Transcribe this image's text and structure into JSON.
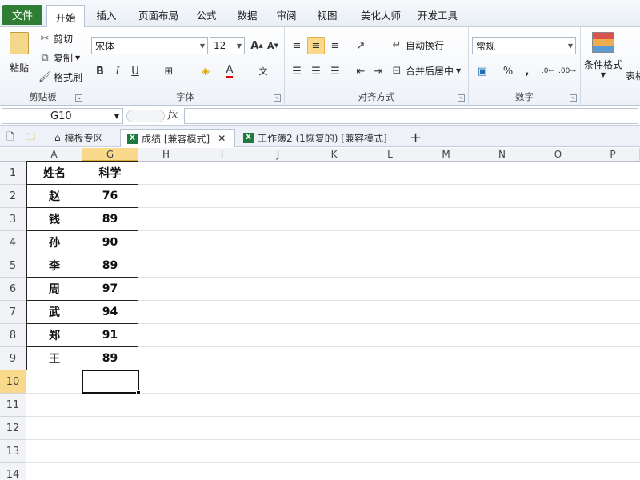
{
  "menu": {
    "file": "文件",
    "tabs": [
      "开始",
      "插入",
      "页面布局",
      "公式",
      "数据",
      "审阅",
      "视图",
      "美化大师",
      "开发工具"
    ]
  },
  "ribbon": {
    "clipboard": {
      "paste": "粘贴",
      "cut": "剪切",
      "copy": "复制",
      "format_painter": "格式刷",
      "label": "剪贴板"
    },
    "font": {
      "name": "宋体",
      "size": "12",
      "bold": "B",
      "italic": "I",
      "underline": "U",
      "label": "字体"
    },
    "alignment": {
      "wrap": "自动换行",
      "merge": "合并后居中",
      "label": "对齐方式"
    },
    "number": {
      "format": "常规",
      "percent": "%",
      "comma": ",",
      "label": "数字"
    },
    "styles": {
      "conditional": "条件格式",
      "table": "表格"
    }
  },
  "formula_bar": {
    "name_box": "G10",
    "fx": "fx",
    "value": ""
  },
  "doc_tabs": [
    {
      "label": "模板专区",
      "icon": "home-icon"
    },
    {
      "label": "成绩 [兼容模式]",
      "icon": "excel-icon",
      "active": true
    },
    {
      "label": "工作簿2 (1恢复的) [兼容模式]",
      "icon": "excel-icon"
    }
  ],
  "columns": [
    "A",
    "G",
    "H",
    "I",
    "J",
    "K",
    "L",
    "M",
    "N",
    "O",
    "P"
  ],
  "rows": [
    "1",
    "2",
    "3",
    "4",
    "5",
    "6",
    "7",
    "8",
    "9",
    "10",
    "11",
    "12",
    "13",
    "14"
  ],
  "table": {
    "headers": [
      "姓名",
      "科学"
    ],
    "rows": [
      [
        "赵",
        "76"
      ],
      [
        "钱",
        "89"
      ],
      [
        "孙",
        "90"
      ],
      [
        "李",
        "89"
      ],
      [
        "周",
        "97"
      ],
      [
        "武",
        "94"
      ],
      [
        "郑",
        "91"
      ],
      [
        "王",
        "89"
      ]
    ]
  },
  "accent_color": "#2e7d32",
  "selection_color": "#f9d98c"
}
